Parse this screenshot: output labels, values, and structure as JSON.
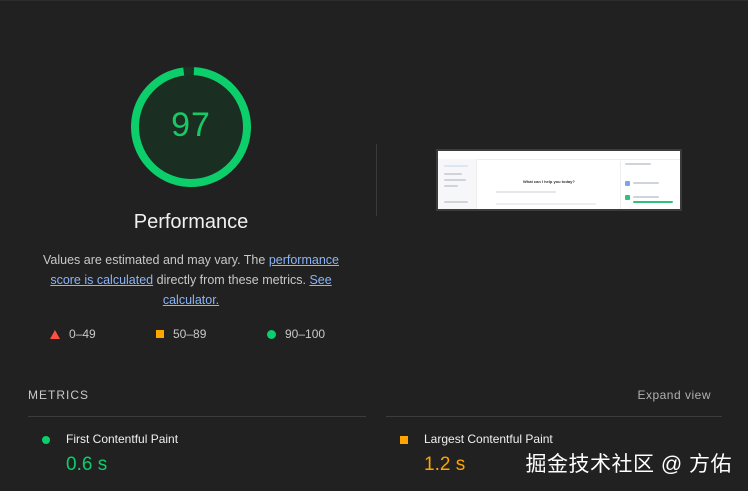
{
  "score": {
    "value": "97",
    "fraction": 0.97,
    "color": "#0cce6b",
    "title": "Performance"
  },
  "description": {
    "text_1": "Values are estimated and may vary. The ",
    "link_1": "performance score is calculated",
    "text_2": " directly from these metrics. ",
    "link_2": "See calculator."
  },
  "legend": [
    {
      "label": "0–49",
      "icon": "red-triangle-icon",
      "color": "#ff4e42"
    },
    {
      "label": "50–89",
      "icon": "orange-square-icon",
      "color": "#ffa400"
    },
    {
      "label": "90–100",
      "icon": "green-circle-icon",
      "color": "#0cce6b"
    }
  ],
  "thumbnail": {
    "heading": "What can I help you today?"
  },
  "metrics": {
    "title": "METRICS",
    "expand_label": "Expand view",
    "items": [
      {
        "name": "First Contentful Paint",
        "value": "0.6 s",
        "status": "pass",
        "color": "#0cce6b"
      },
      {
        "name": "Largest Contentful Paint",
        "value": "1.2 s",
        "status": "average",
        "color": "#ffa400"
      }
    ]
  },
  "watermark": "掘金技术社区 @ 方佑"
}
